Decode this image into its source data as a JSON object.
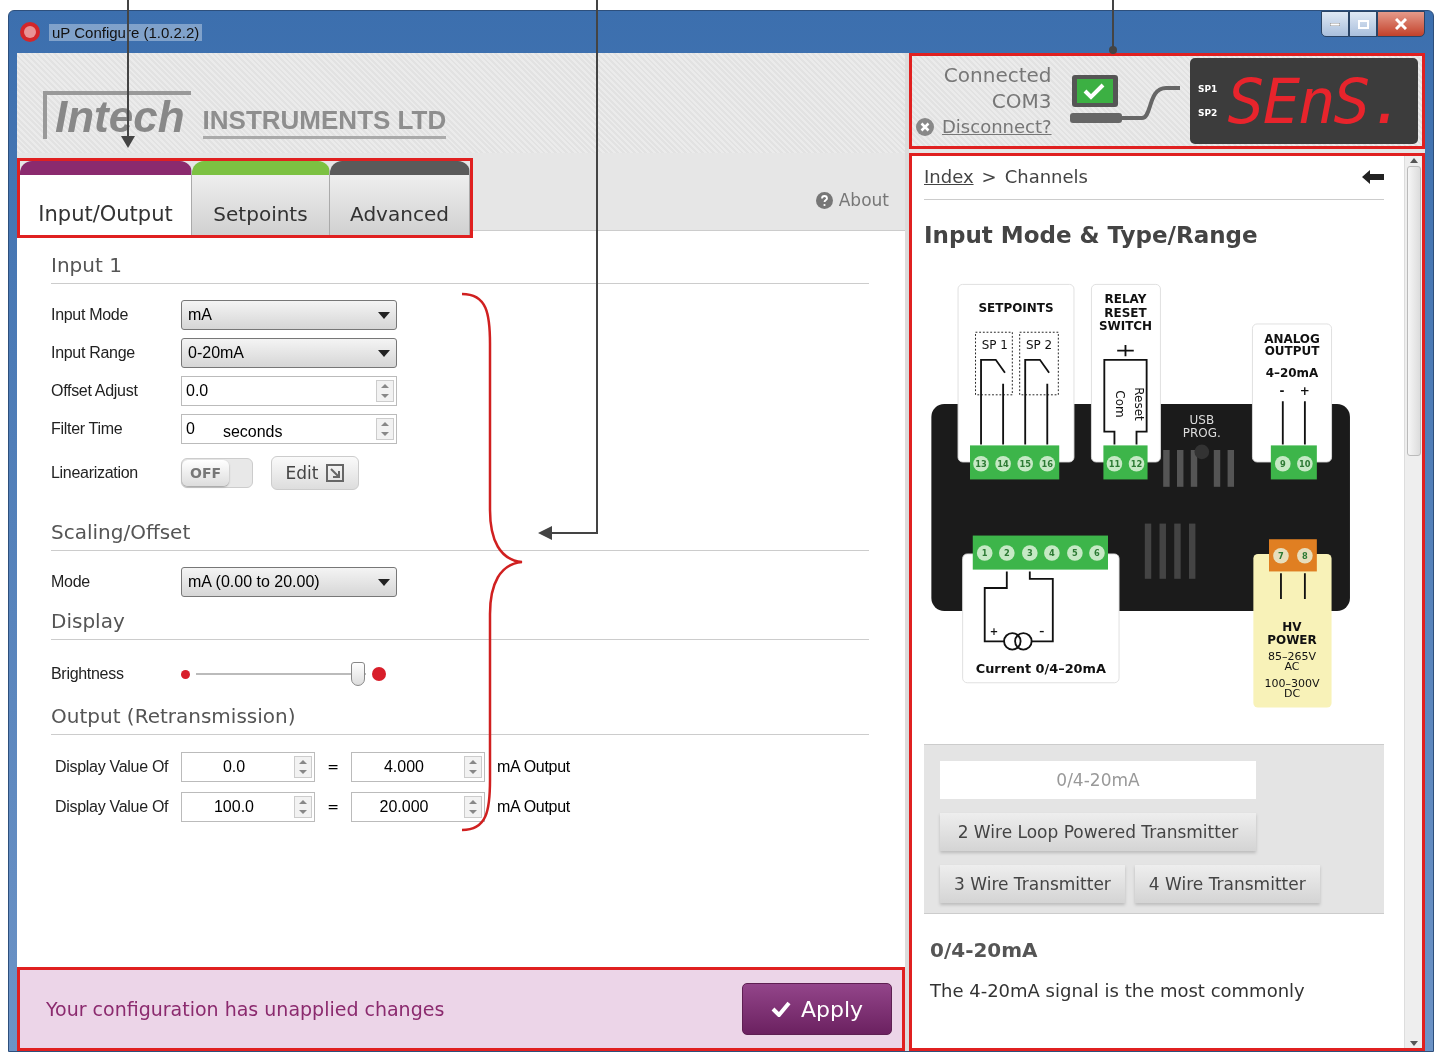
{
  "window": {
    "title": "uP Configure (1.0.2.2)"
  },
  "logo": {
    "brand": "Intech",
    "subtitle": "INSTRUMENTS LTD"
  },
  "tabs": [
    {
      "label": "Input/Output",
      "selected": true,
      "color": "#8b2a6e"
    },
    {
      "label": "Setpoints",
      "selected": false,
      "color": "#7cc142"
    },
    {
      "label": "Advanced",
      "selected": false,
      "color": "#5a5a5a"
    }
  ],
  "about": "About",
  "sections": [
    {
      "title": "Input 1",
      "rows": [
        {
          "kind": "select",
          "label": "Input Mode",
          "value": "mA"
        },
        {
          "kind": "select",
          "label": "Input Range",
          "value": "0-20mA"
        },
        {
          "kind": "spin",
          "label": "Offset Adjust",
          "value": "0.0"
        },
        {
          "kind": "spin",
          "label": "Filter Time",
          "value": "0",
          "unit": "seconds"
        },
        {
          "kind": "toggle",
          "label": "Linearization",
          "toggle_label": "OFF",
          "on": false,
          "button": "Edit"
        }
      ]
    },
    {
      "title": "Scaling/Offset",
      "rows": [
        {
          "kind": "select",
          "label": "Mode",
          "value": "mA (0.00 to 20.00)"
        }
      ]
    },
    {
      "title": "Display",
      "rows": [
        {
          "kind": "slider",
          "label": "Brightness",
          "level": 0.95
        }
      ]
    },
    {
      "title": "Output (Retransmission)",
      "rows": [
        {
          "kind": "mapping",
          "label": "Display Value Of",
          "value": "0.0",
          "equals": "=",
          "output": "4.000",
          "unit": "mA Output"
        },
        {
          "kind": "mapping",
          "label": "Display Value Of",
          "value": "100.0",
          "equals": "=",
          "output": "20.000",
          "unit": "mA Output"
        }
      ]
    }
  ],
  "status": {
    "message": "Your configuration has unapplied changes",
    "button": "Apply"
  },
  "connection": {
    "status": "Connected",
    "port": "COM3",
    "disconnect": "Disconnect?",
    "display_labels": [
      "SP1",
      "SP2"
    ],
    "display_text": "SEnS."
  },
  "help": {
    "breadcrumb_link": "Index",
    "separator": ">",
    "breadcrumb_current": "Channels",
    "title": "Input Mode & Type/Range",
    "diagram": {
      "setpoints_title": "SETPOINTS",
      "relays": [
        "SP 1",
        "SP 2"
      ],
      "setpoint_terminals": [
        "13",
        "14",
        "15",
        "16"
      ],
      "relay_title": [
        "RELAY",
        "RESET",
        "SWITCH"
      ],
      "relay_wires": [
        "Com",
        "Reset"
      ],
      "relay_terminals": [
        "11",
        "12"
      ],
      "usb": [
        "USB",
        "PROG."
      ],
      "analog_title": [
        "ANALOG",
        "OUTPUT"
      ],
      "analog_range": "4–20mA",
      "analog_poles": [
        "-",
        "+"
      ],
      "analog_terminals": [
        "9",
        "10"
      ],
      "input_terminals": [
        "1",
        "2",
        "3",
        "4",
        "5",
        "6"
      ],
      "input_poles": [
        "+",
        "–"
      ],
      "input_label": "Current 0/4–20mA",
      "power_terminals": [
        "7",
        "8"
      ],
      "power_title": [
        "HV",
        "POWER"
      ],
      "power_ac": [
        "85–265V",
        "AC"
      ],
      "power_dc": [
        "100–300V",
        "DC"
      ]
    },
    "options": [
      {
        "label": "0/4-20mA",
        "selected": true
      },
      {
        "label": "2 Wire Loop Powered Transmitter",
        "selected": false
      },
      {
        "label": "3 Wire Transmitter",
        "selected": false
      },
      {
        "label": "4 Wire Transmitter",
        "selected": false
      }
    ],
    "subtitle": "0/4-20mA",
    "paragraph": "The 4-20mA signal is the most commonly"
  }
}
